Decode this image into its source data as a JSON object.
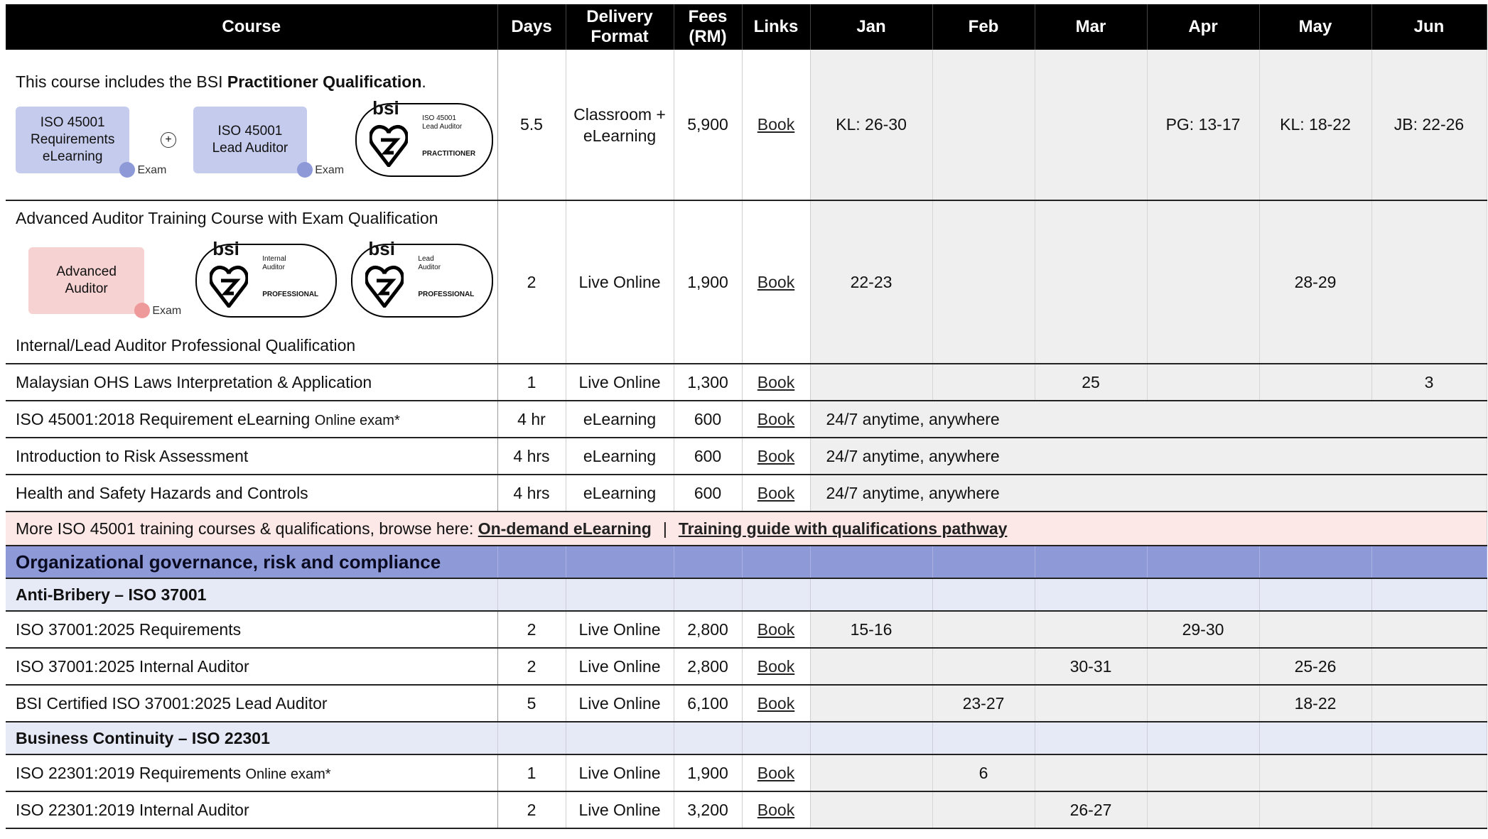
{
  "header": {
    "course": "Course",
    "days": "Days",
    "delivery_1": "Delivery",
    "delivery_2": "Format",
    "fees_1": "Fees",
    "fees_2": "(RM)",
    "links": "Links",
    "months": [
      "Jan",
      "Feb",
      "Mar",
      "Apr",
      "May",
      "Jun"
    ]
  },
  "practitioner": {
    "intro_prefix": "This course includes the BSI ",
    "intro_bold": "Practitioner Qualification",
    "intro_suffix": ".",
    "badge1": "ISO 45001 Requirements eLearning",
    "badge2": "ISO 45001 Lead Auditor",
    "exam": "Exam",
    "seal_line1": "ISO 45001",
    "seal_line2": "Lead Auditor",
    "seal_label": "PRACTITIONER",
    "bsi": "bsi",
    "days": "5.5",
    "delivery": "Classroom + eLearning",
    "fees": "5,900",
    "link": "Book",
    "jan": "KL: 26-30",
    "feb": "",
    "mar": "",
    "apr": "PG: 13-17",
    "may": "KL: 18-22",
    "jun": "JB: 22-26"
  },
  "advanced": {
    "title": "Advanced Auditor Training Course with Exam Qualification",
    "badge": "Advanced Auditor",
    "exam": "Exam",
    "seal1_line1": "Internal",
    "seal1_line2": "Auditor",
    "seal2_line1": "Lead",
    "seal2_line2": "Auditor",
    "seal_label": "PROFESSIONAL",
    "bsi": "bsi",
    "footer": "Internal/Lead Auditor Professional Qualification",
    "days": "2",
    "delivery": "Live Online",
    "fees": "1,900",
    "link": "Book",
    "jan": "22-23",
    "may": "28-29"
  },
  "rows": [
    {
      "course": "Malaysian OHS Laws Interpretation & Application",
      "note": "",
      "days": "1",
      "delivery": "Live Online",
      "fees": "1,300",
      "link": "Book",
      "months": [
        "",
        "",
        "25",
        "",
        "",
        "3"
      ]
    },
    {
      "course": "ISO 45001:2018 Requirement eLearning ",
      "note": "Online exam*",
      "days": "4 hr",
      "delivery": "eLearning",
      "fees": "600",
      "link": "Book",
      "span": "24/7 anytime, anywhere"
    },
    {
      "course": "Introduction to Risk Assessment",
      "note": "",
      "days": "4 hrs",
      "delivery": "eLearning",
      "fees": "600",
      "link": "Book",
      "span": "24/7 anytime, anywhere"
    },
    {
      "course": "Health and Safety Hazards and Controls",
      "note": "",
      "days": "4 hrs",
      "delivery": "eLearning",
      "fees": "600",
      "link": "Book",
      "span": "24/7 anytime, anywhere"
    }
  ],
  "browse": {
    "prefix": "More ISO 45001 training courses & qualifications, browse here: ",
    "link1": "On-demand eLearning",
    "sep": "|",
    "link2": "Training guide with qualifications pathway"
  },
  "section": "Organizational governance, risk and compliance",
  "antibribery": {
    "heading": "Anti-Bribery – ISO 37001",
    "rows": [
      {
        "course": "ISO 37001:2025 Requirements",
        "days": "2",
        "delivery": "Live Online",
        "fees": "2,800",
        "link": "Book",
        "months": [
          "15-16",
          "",
          "",
          "29-30",
          "",
          ""
        ]
      },
      {
        "course": "ISO 37001:2025 Internal Auditor",
        "days": "2",
        "delivery": "Live Online",
        "fees": "2,800",
        "link": "Book",
        "months": [
          "",
          "",
          "30-31",
          "",
          "25-26",
          ""
        ]
      },
      {
        "course": "BSI Certified ISO 37001:2025 Lead Auditor",
        "days": "5",
        "delivery": "Live Online",
        "fees": "6,100",
        "link": "Book",
        "months": [
          "",
          "23-27",
          "",
          "",
          "18-22",
          ""
        ]
      }
    ]
  },
  "continuity": {
    "heading": "Business Continuity – ISO 22301",
    "rows": [
      {
        "course": "ISO 22301:2019 Requirements ",
        "note": "Online exam*",
        "days": "1",
        "delivery": "Live Online",
        "fees": "1,900",
        "link": "Book",
        "months": [
          "",
          "6",
          "",
          "",
          "",
          ""
        ]
      },
      {
        "course": "ISO 22301:2019 Internal Auditor",
        "note": "",
        "days": "2",
        "delivery": "Live Online",
        "fees": "3,200",
        "link": "Book",
        "months": [
          "",
          "",
          "26-27",
          "",
          "",
          ""
        ]
      }
    ]
  }
}
